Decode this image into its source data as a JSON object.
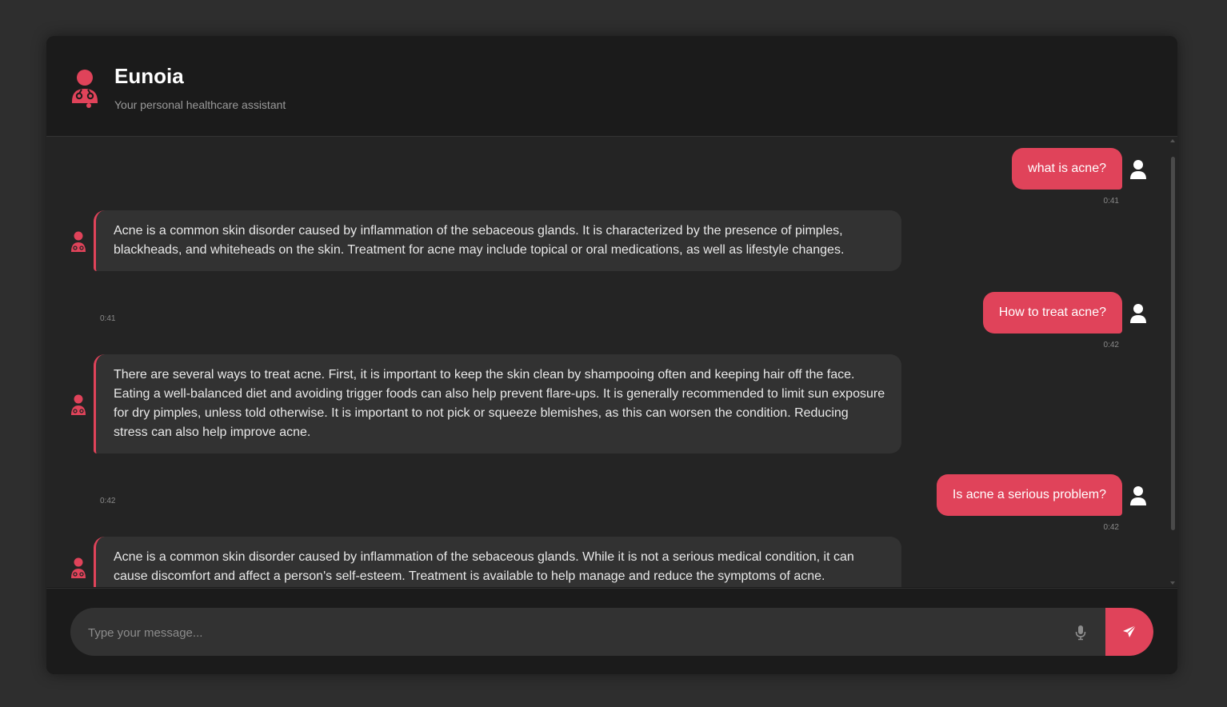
{
  "header": {
    "title": "Eunoia",
    "subtitle": "Your personal healthcare assistant",
    "icon": "doctor-icon"
  },
  "messages": [
    {
      "role": "user",
      "text": "what is acne?",
      "time": "0:41"
    },
    {
      "role": "bot",
      "text": "Acne is a common skin disorder caused by inflammation of the sebaceous glands. It is characterized by the presence of pimples, blackheads, and whiteheads on the skin. Treatment for acne may include topical or oral medications, as well as lifestyle changes.",
      "time": "0:41"
    },
    {
      "role": "user",
      "text": "How to treat acne?",
      "time": "0:42"
    },
    {
      "role": "bot",
      "text": "There are several ways to treat acne. First, it is important to keep the skin clean by shampooing often and keeping hair off the face. Eating a well-balanced diet and avoiding trigger foods can also help prevent flare-ups. It is generally recommended to limit sun exposure for dry pimples, unless told otherwise. It is important to not pick or squeeze blemishes, as this can worsen the condition. Reducing stress can also help improve acne.",
      "time": "0:42"
    },
    {
      "role": "user",
      "text": "Is acne a serious problem?",
      "time": "0:42"
    },
    {
      "role": "bot",
      "text": "Acne is a common skin disorder caused by inflammation of the sebaceous glands. While it is not a serious medical condition, it can cause discomfort and affect a person's self-esteem. Treatment is available to help manage and reduce the symptoms of acne.",
      "time": ""
    }
  ],
  "composer": {
    "placeholder": "Type your message...",
    "mic_icon": "microphone-icon",
    "send_icon": "paper-plane-icon"
  },
  "colors": {
    "accent": "#e0435a",
    "background": "#242424",
    "bot_bubble": "#323232"
  }
}
